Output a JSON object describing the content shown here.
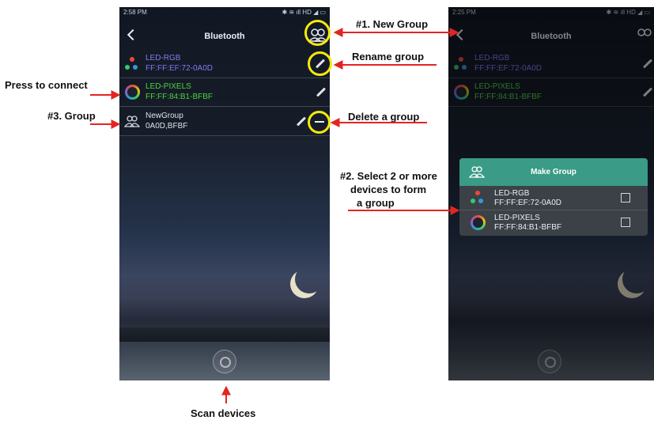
{
  "annotations": {
    "new_group": "#1. New Group",
    "rename_group": "Rename group",
    "press_to_connect": "Press to connect",
    "group": "#3. Group",
    "delete_group": "Delete a group",
    "select_devices": [
      "#2. Select 2 or more",
      "devices to form",
      "a group"
    ],
    "scan_devices": "Scan devices"
  },
  "colors": {
    "highlight": "#f5e90d",
    "arrow": "#e32521",
    "rgb_text": "#7f7cf0",
    "pixels_text": "#4fd13e",
    "modal_header": "#3a9b86"
  },
  "left_phone": {
    "status_time": "2:58 PM",
    "status_icons": "✱ ≋ ıll HD ◢ ▭",
    "title": "Bluetooth",
    "back_icon": "chevron-left",
    "devices": [
      {
        "name": "LED-RGB",
        "mac": "FF:FF:EF:72-0A0D"
      },
      {
        "name": "LED-PIXELS",
        "mac": "FF:FF:84:B1-BFBF"
      },
      {
        "name": "NewGroup",
        "mac": "0A0D,BFBF"
      }
    ]
  },
  "right_phone": {
    "status_time": "2:25 PM",
    "status_icons": "✱ ≋ ıll HD ◢ ▭",
    "title": "Bluetooth",
    "devices": [
      {
        "name": "LED-RGB",
        "mac": "FF:FF:EF:72-0A0D"
      },
      {
        "name": "LED-PIXELS",
        "mac": "FF:FF:84:B1-BFBF"
      }
    ],
    "modal": {
      "title": "Make Group",
      "items": [
        {
          "name": "LED-RGB",
          "mac": "FF:FF:EF:72-0A0D"
        },
        {
          "name": "LED-PIXELS",
          "mac": "FF:FF:84:B1-BFBF"
        }
      ]
    }
  }
}
